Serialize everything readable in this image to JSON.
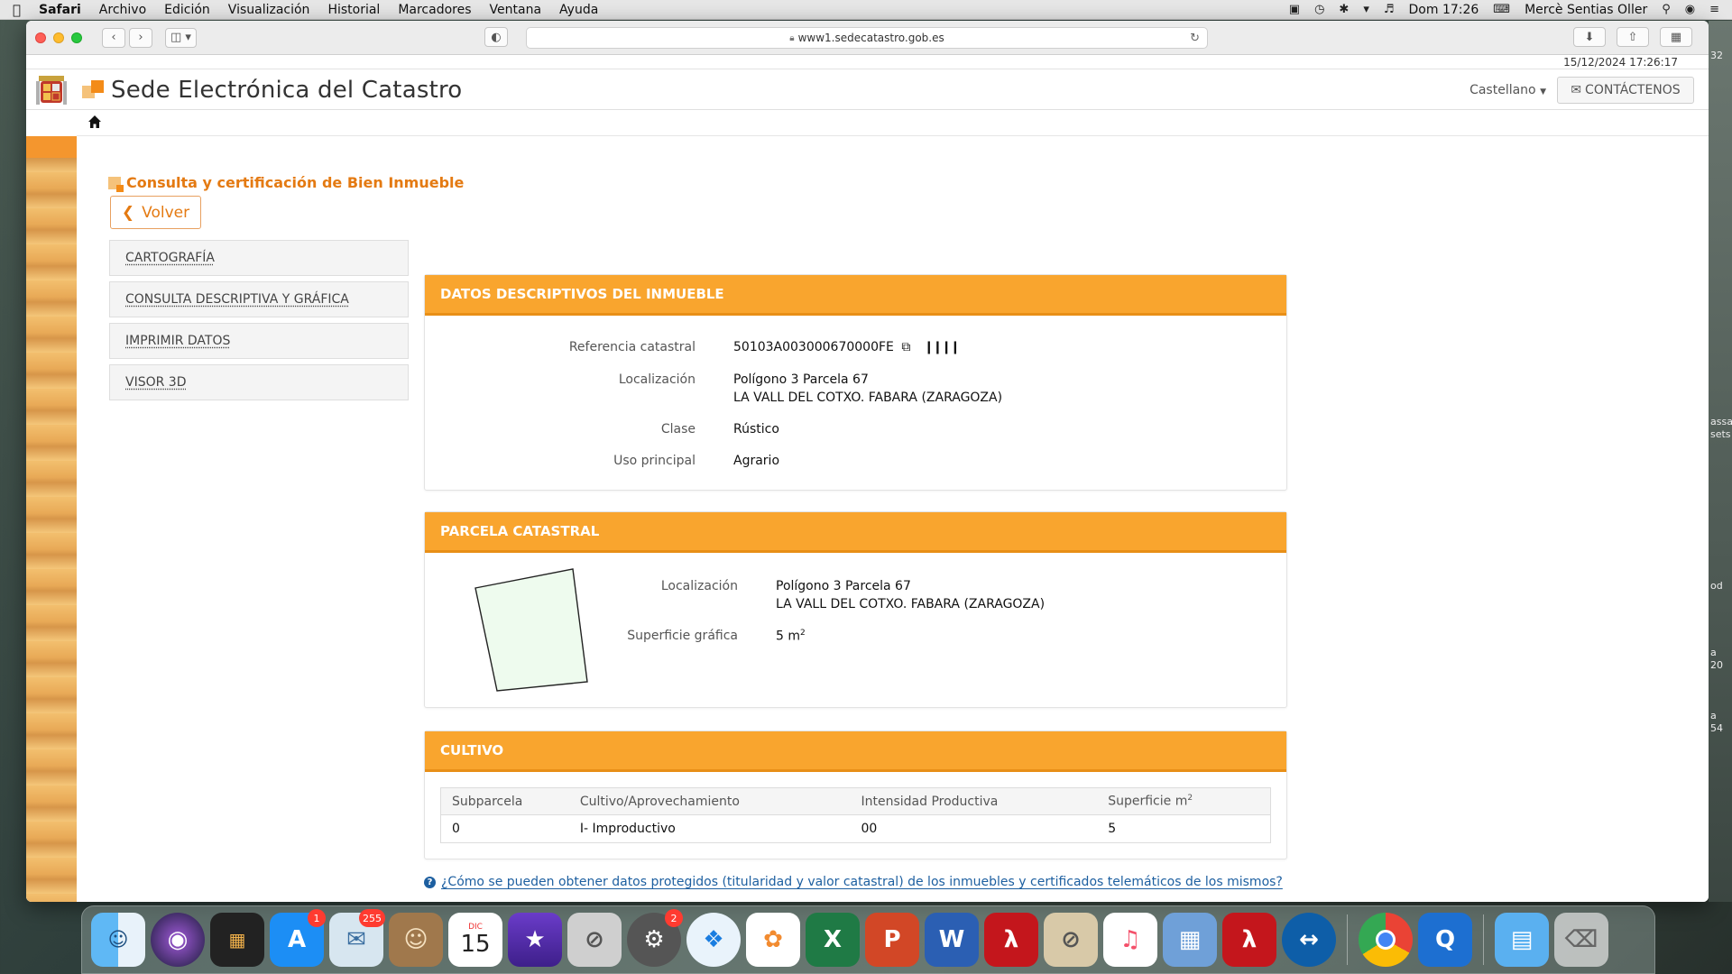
{
  "menubar": {
    "app": "Safari",
    "items": [
      "Archivo",
      "Edición",
      "Visualización",
      "Historial",
      "Marcadores",
      "Ventana",
      "Ayuda"
    ],
    "datetime": "Dom 17:26",
    "user": "Mercè Sentias Oller"
  },
  "browser": {
    "url": "www1.sedecatastro.gob.es"
  },
  "site": {
    "datestamp": "15/12/2024  17:26:17",
    "title": "Sede Electrónica del Catastro",
    "language": "Castellano",
    "contact_label": "CONTÁCTENOS"
  },
  "page": {
    "heading": "Consulta y certificación de Bien Inmueble",
    "back_label": "Volver"
  },
  "sidenav": {
    "items": [
      {
        "label": "CARTOGRAFÍA"
      },
      {
        "label": "CONSULTA DESCRIPTIVA Y GRÁFICA"
      },
      {
        "label": "IMPRIMIR DATOS"
      },
      {
        "label": "VISOR 3D"
      }
    ]
  },
  "datos": {
    "title": "DATOS DESCRIPTIVOS DEL INMUEBLE",
    "ref_label": "Referencia catastral",
    "ref_value": "50103A003000670000FE",
    "loc_label": "Localización",
    "loc_line1": "Polígono 3 Parcela 67",
    "loc_line2": "LA VALL DEL COTXO. FABARA (ZARAGOZA)",
    "clase_label": "Clase",
    "clase_value": "Rústico",
    "uso_label": "Uso principal",
    "uso_value": "Agrario"
  },
  "parcela": {
    "title": "PARCELA CATASTRAL",
    "loc_label": "Localización",
    "loc_line1": "Polígono 3 Parcela 67",
    "loc_line2": "LA VALL DEL COTXO. FABARA (ZARAGOZA)",
    "sup_label": "Superficie gráfica",
    "sup_value": "5 m",
    "sup_unit_exp": "2"
  },
  "cultivo": {
    "title": "CULTIVO",
    "headers": [
      "Subparcela",
      "Cultivo/Aprovechamiento",
      "Intensidad Productiva",
      "Superficie m"
    ],
    "header_exp": "2",
    "rows": [
      [
        "0",
        "I- Improductivo",
        "00",
        "5"
      ]
    ]
  },
  "help_link": "¿Cómo se pueden obtener datos protegidos (titularidad y valor catastral) de los inmuebles y certificados telemáticos de los mismos?",
  "edge_chips": [
    "32",
    "assa",
    "sets",
    "od",
    "a",
    "20",
    "a",
    "54"
  ],
  "dock": {
    "badges": {
      "appstore": "1",
      "mail": "255",
      "settings": "2"
    },
    "calendar_month": "DIC",
    "calendar_day": "15"
  }
}
